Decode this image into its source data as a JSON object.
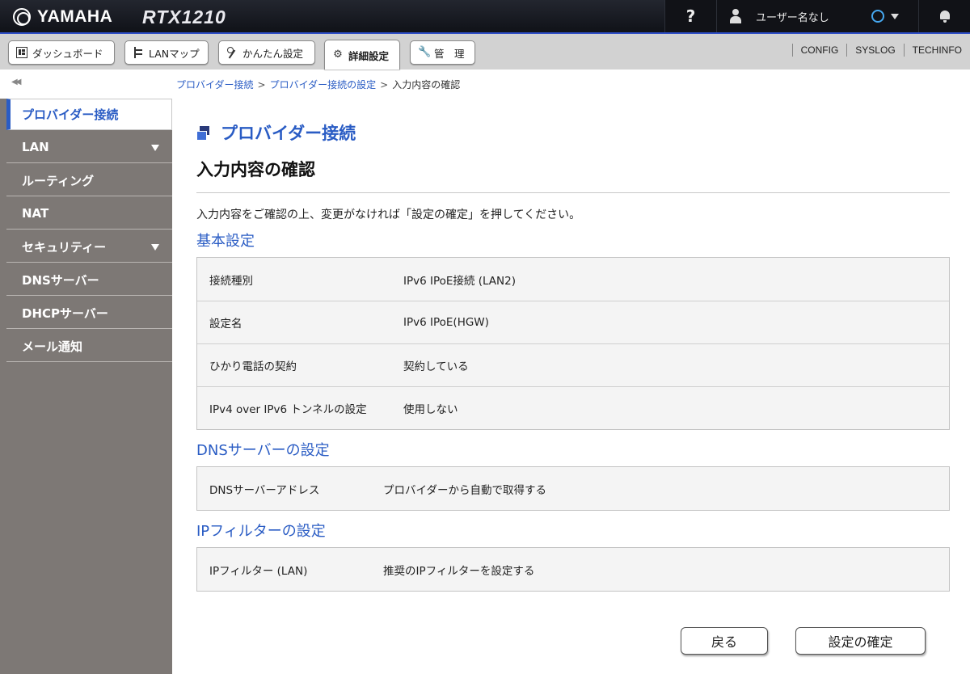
{
  "header": {
    "brand": "YAMAHA",
    "model": "RTX1210",
    "help": "?",
    "user": "ユーザー名なし"
  },
  "tabs": [
    {
      "label": "ダッシュボード",
      "icon": "dashboard-icon"
    },
    {
      "label": "LANマップ",
      "icon": "lan-map-icon"
    },
    {
      "label": "かんたん設定",
      "icon": "wand-icon"
    },
    {
      "label": "詳細設定",
      "icon": "gear-icon"
    },
    {
      "label": "管　理",
      "icon": "wrench-icon"
    }
  ],
  "active_tab": "詳細設定",
  "tab_links": [
    "CONFIG",
    "SYSLOG",
    "TECHINFO"
  ],
  "sidebar": {
    "items": [
      {
        "label": "プロバイダー接続",
        "selected": true
      },
      {
        "label": "LAN",
        "has_submenu": true
      },
      {
        "label": "ルーティング"
      },
      {
        "label": "NAT"
      },
      {
        "label": "セキュリティー",
        "has_submenu": true
      },
      {
        "label": "DNSサーバー"
      },
      {
        "label": "DHCPサーバー"
      },
      {
        "label": "メール通知"
      }
    ]
  },
  "breadcrumb": [
    "プロバイダー接続",
    "プロバイダー接続の設定",
    "入力内容の確認"
  ],
  "page": {
    "title": "プロバイダー接続",
    "subtitle": "入力内容の確認",
    "description": "入力内容をご確認の上、変更がなければ「設定の確定」を押してください。"
  },
  "sections": [
    {
      "title": "基本設定",
      "rows": [
        {
          "label": "接続種別",
          "value": "IPv6 IPoE接続 (LAN2)"
        },
        {
          "label": "設定名",
          "value": "IPv6 IPoE(HGW)"
        },
        {
          "label": "ひかり電話の契約",
          "value": "契約している"
        },
        {
          "label": "IPv4 over IPv6 トンネルの設定",
          "value": "使用しない"
        }
      ]
    },
    {
      "title": "DNSサーバーの設定",
      "rows": [
        {
          "label": "DNSサーバーアドレス",
          "value": "プロバイダーから自動で取得する"
        }
      ]
    },
    {
      "title": "IPフィルターの設定",
      "rows": [
        {
          "label": "IPフィルター (LAN)",
          "value": "推奨のIPフィルターを設定する"
        }
      ]
    }
  ],
  "buttons": {
    "back": "戻る",
    "confirm": "設定の確定"
  },
  "colors": {
    "accent": "#2a5cc4",
    "sidebar_bg": "#7d7875",
    "topbar_bg": "#16181f",
    "tabbar_bg": "#d2d2d2"
  }
}
